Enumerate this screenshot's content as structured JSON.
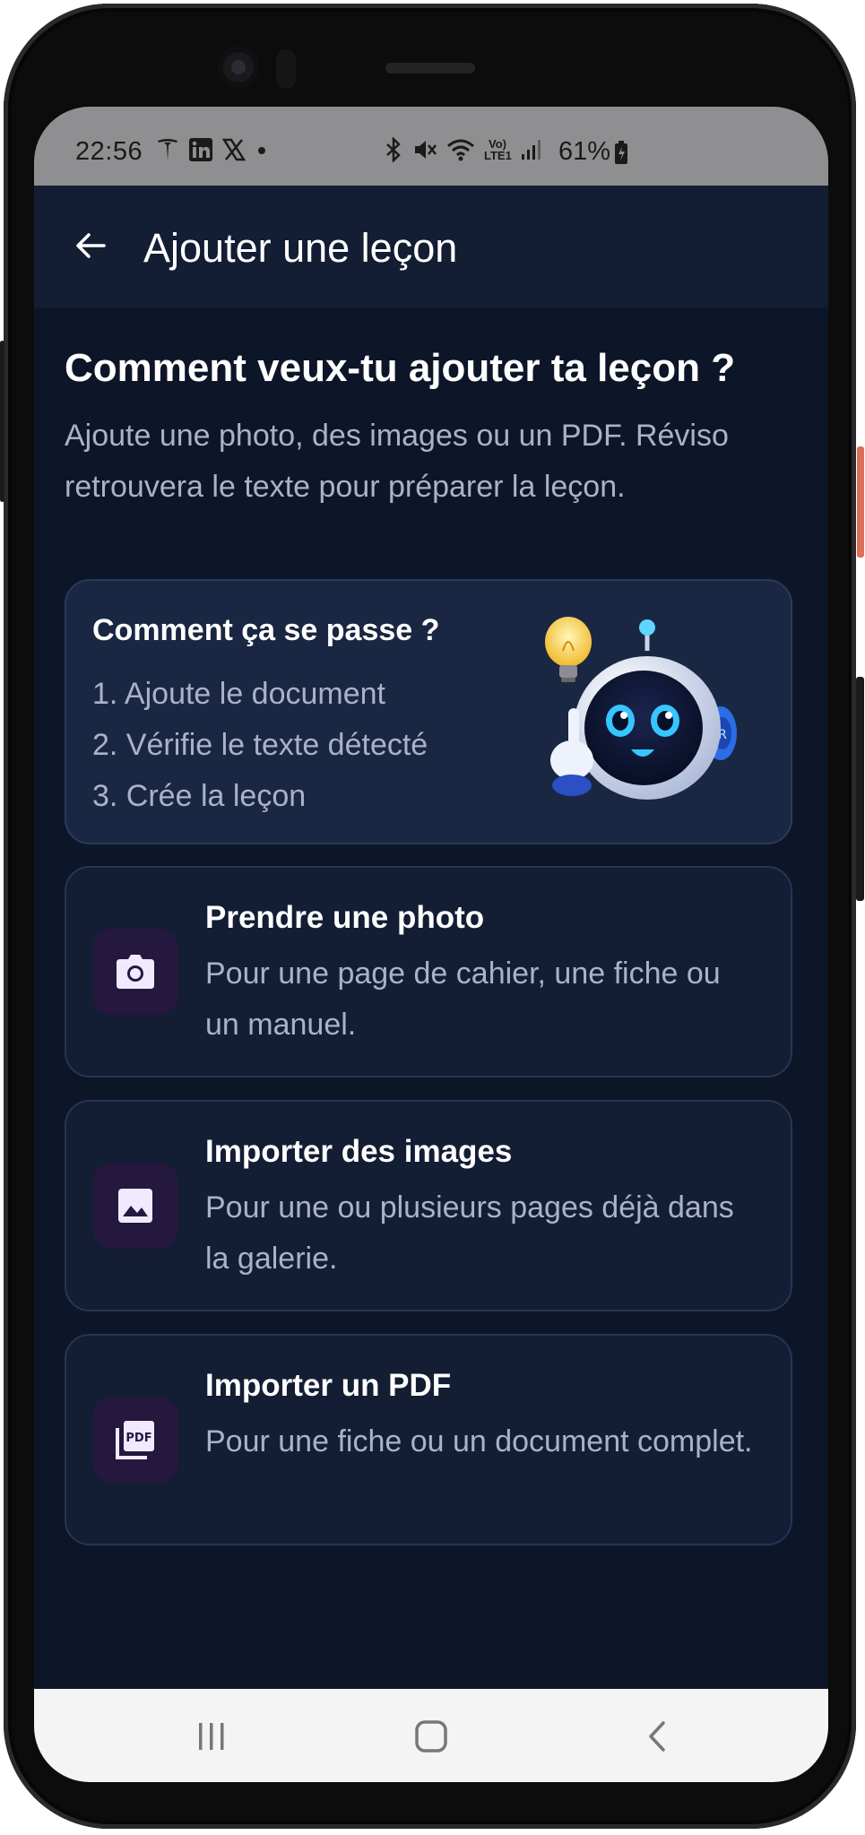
{
  "status_bar": {
    "time": "22:56",
    "battery": "61%",
    "volte_label": "Vo) LTE1",
    "notification_icons": [
      "tesla-icon",
      "linkedin-icon",
      "x-icon",
      "dot-icon"
    ],
    "system_icons": [
      "bluetooth-icon",
      "mute-icon",
      "wifi-icon",
      "volte-icon",
      "signal-icon",
      "battery-icon"
    ]
  },
  "app_bar": {
    "title": "Ajouter une leçon",
    "back_icon": "arrow-left-icon"
  },
  "main": {
    "heading": "Comment veux-tu ajouter ta leçon ?",
    "intro": "Ajoute une photo, des images ou un PDF. Réviso retrouvera le texte pour préparer la leçon.",
    "howto": {
      "title": "Comment ça se passe ?",
      "steps": [
        "1. Ajoute le document",
        "2. Vérifie le texte détecté",
        "3. Crée la leçon"
      ],
      "mascot_badge": "R"
    },
    "options": [
      {
        "icon": "camera-icon",
        "title": "Prendre une photo",
        "description": "Pour une page de cahier, une fiche ou un manuel."
      },
      {
        "icon": "image-icon",
        "title": "Importer des images",
        "description": "Pour une ou plusieurs pages déjà dans la galerie."
      },
      {
        "icon": "pdf-icon",
        "title": "Importer un PDF",
        "description": "Pour une fiche ou un document complet.",
        "icon_label": "PDF"
      }
    ]
  },
  "nav_bar": {
    "buttons": [
      "recent-apps-icon",
      "home-icon",
      "back-icon"
    ]
  },
  "colors": {
    "background": "#0d1628",
    "app_bar": "#131d33",
    "card": "#131d33",
    "howto_card": "#1a2742",
    "icon_box": "#24183f",
    "text_primary": "#ffffff",
    "text_secondary": "#a9b2c6"
  }
}
